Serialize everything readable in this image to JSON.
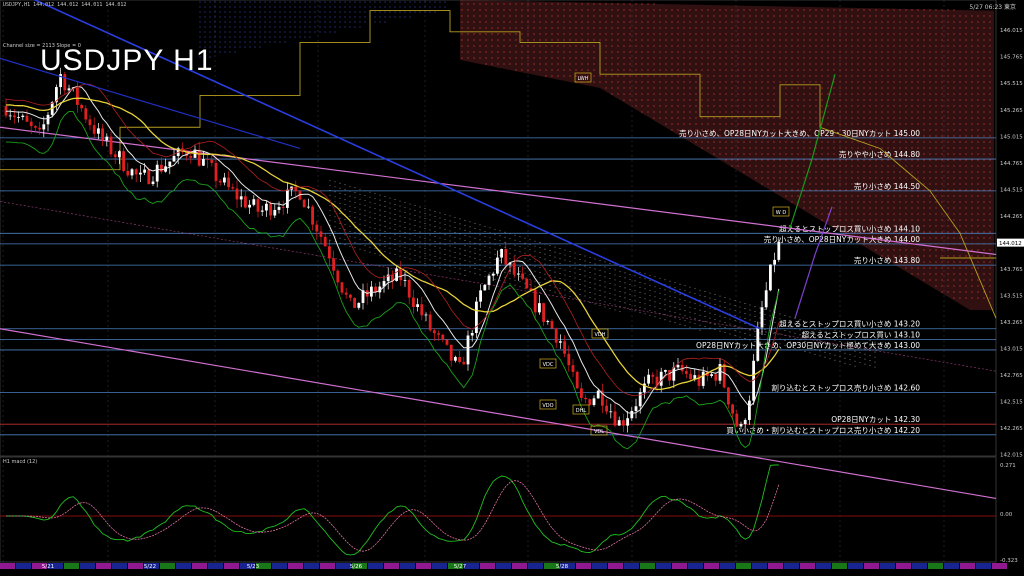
{
  "header": {
    "symbol_line": "USDJPY,H1  144.012 144.012 144.011 144.012",
    "channel_line": "Channel size = 2113 Slope = 0",
    "clock": "5/27 06:23 東京",
    "big_title": "USDJPY H1",
    "macd_title": "H1  macd (12)"
  },
  "chart_data": {
    "type": "line",
    "title": "USDJPY H1",
    "price_axis": {
      "ylim": [
        142.0,
        146.3
      ],
      "ticks": [
        "146.015",
        "145.765",
        "145.515",
        "145.265",
        "145.015",
        "144.765",
        "144.515",
        "144.265",
        "144.015",
        "143.765",
        "143.515",
        "143.265",
        "143.015",
        "142.765",
        "142.515",
        "142.265",
        "142.015"
      ],
      "current_price": "144.012"
    },
    "date_labels": [
      "5/21",
      "5/22",
      "5/23",
      "5/26",
      "5/27",
      "5/28"
    ],
    "levels": [
      {
        "price": 145.0,
        "label": "売り小さめ、OP28日NYカット大きめ、OP29・30日NYカット 145.00",
        "color": "#4a7fc0"
      },
      {
        "price": 144.8,
        "label": "売りやや小さめ 144.80",
        "color": "#4a7fc0"
      },
      {
        "price": 144.5,
        "label": "売り小さめ 144.50",
        "color": "#4a7fc0"
      },
      {
        "price": 144.1,
        "label": "超えるとストップロス買い小さめ 144.10",
        "color": "#4a7fc0"
      },
      {
        "price": 144.0,
        "label": "売り小さめ、OP28日NYカット大きめ 144.00",
        "color": "#4a7fc0"
      },
      {
        "price": 143.8,
        "label": "売り小さめ 143.80",
        "color": "#4a7fc0"
      },
      {
        "price": 143.2,
        "label": "超えるとストップロス買い小さめ 143.20",
        "color": "#4a7fc0"
      },
      {
        "price": 143.1,
        "label": "超えるとストップロス買い 143.10",
        "color": "#4a7fc0"
      },
      {
        "price": 143.0,
        "label": "OP28日NYカット大きめ、OP30日NYカット極めて大きめ 143.00",
        "color": "#4a7fc0"
      },
      {
        "price": 142.6,
        "label": "割り込むとストップロス売り小さめ 142.60",
        "color": "#4a7fc0"
      },
      {
        "price": 142.3,
        "label": "OP28日NYカット 142.30",
        "color": "#c03030"
      },
      {
        "price": 142.2,
        "label": "買い小さめ・割り込むとストップロス売り小さめ 142.20",
        "color": "#4a7fc0"
      }
    ],
    "box_labels": [
      "LWH",
      "VDH",
      "VDC",
      "VDO",
      "DHL",
      "VDL",
      "W D"
    ],
    "macd": {
      "ticks": [
        "0.271",
        "0.00",
        "-0.323"
      ]
    },
    "colors": {
      "bull": "#ffffff",
      "bear": "#e02020",
      "ma_yellow": "#e8d23a",
      "ma_blue": "#2a3ee0",
      "ma_white": "#e8e8e8",
      "channel": "#d070d0",
      "cloud": "#c04040",
      "green": "#1aa01a"
    }
  }
}
